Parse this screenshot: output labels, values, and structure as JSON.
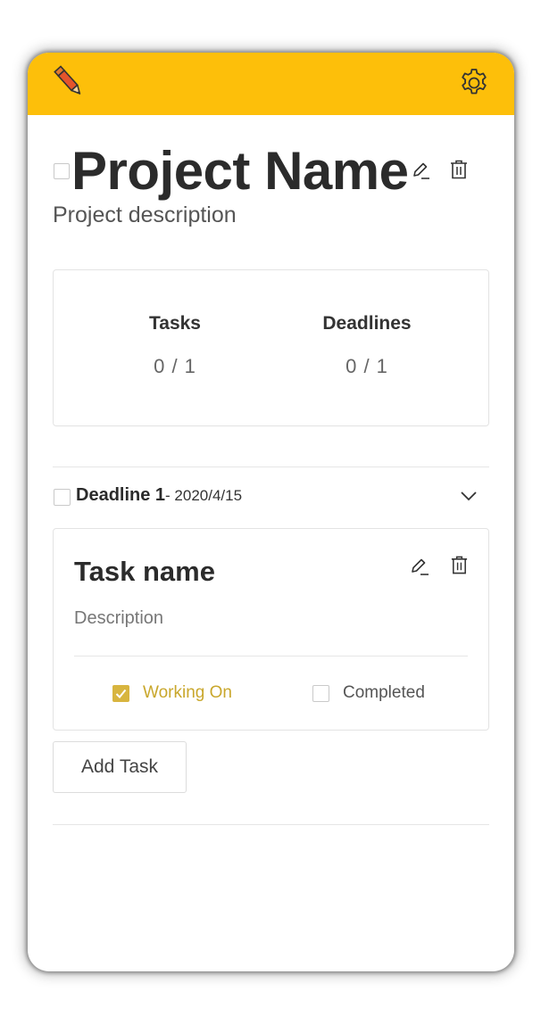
{
  "appbar": {
    "logo_icon": "pencil-icon",
    "settings_icon": "gear-icon",
    "color": "#fdbf0a"
  },
  "project": {
    "title": "Project Name",
    "description": "Project description",
    "completed": false,
    "edit_icon": "edit-icon",
    "delete_icon": "trash-icon"
  },
  "stats": {
    "tasks_label": "Tasks",
    "tasks_value": "0 / 1",
    "deadlines_label": "Deadlines",
    "deadlines_value": "0 / 1"
  },
  "deadline": {
    "title": "Deadline 1",
    "date": "- 2020/4/15",
    "completed": false,
    "expand_icon": "chevron-down-icon"
  },
  "task": {
    "name": "Task name",
    "description": "Description",
    "edit_icon": "edit-icon",
    "delete_icon": "trash-icon",
    "working_on_label": "Working On",
    "working_on_checked": true,
    "completed_label": "Completed",
    "completed_checked": false,
    "accent": "#d8b53f"
  },
  "add_task_label": "Add Task"
}
